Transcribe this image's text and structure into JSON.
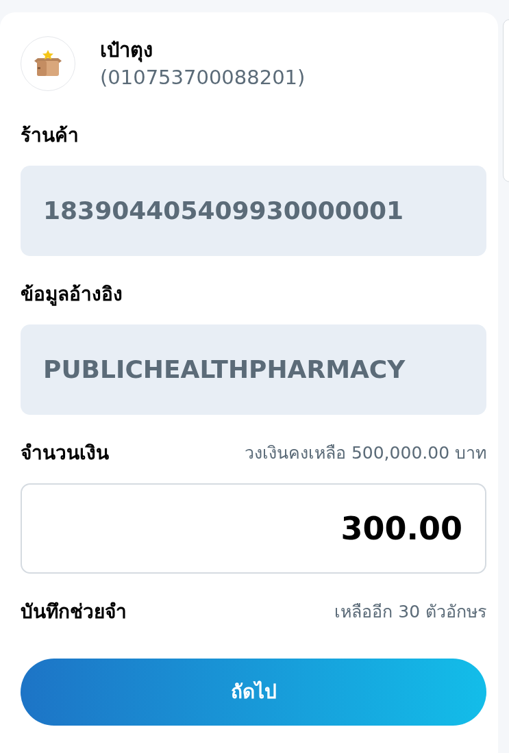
{
  "merchant": {
    "name": "เป๋าตุง",
    "id": "(010753700088201)"
  },
  "fields": [
    {
      "kind": "readonly",
      "label": "ร้านค้า",
      "value": "183904405409930000001"
    },
    {
      "kind": "readonly",
      "label": "ข้อมูลอ้างอิง",
      "value": "PUBLICHEALTHPHARMACY"
    },
    {
      "kind": "amount",
      "label": "จำนวนเงิน",
      "hint": "วงเงินคงเหลือ 500,000.00 บาท",
      "value": "300.00"
    },
    {
      "kind": "note",
      "label": "บันทึกช่วยจำ",
      "hint": "เหลืออีก 30 ตัวอักษร"
    }
  ],
  "next_button": "ถัดไป"
}
